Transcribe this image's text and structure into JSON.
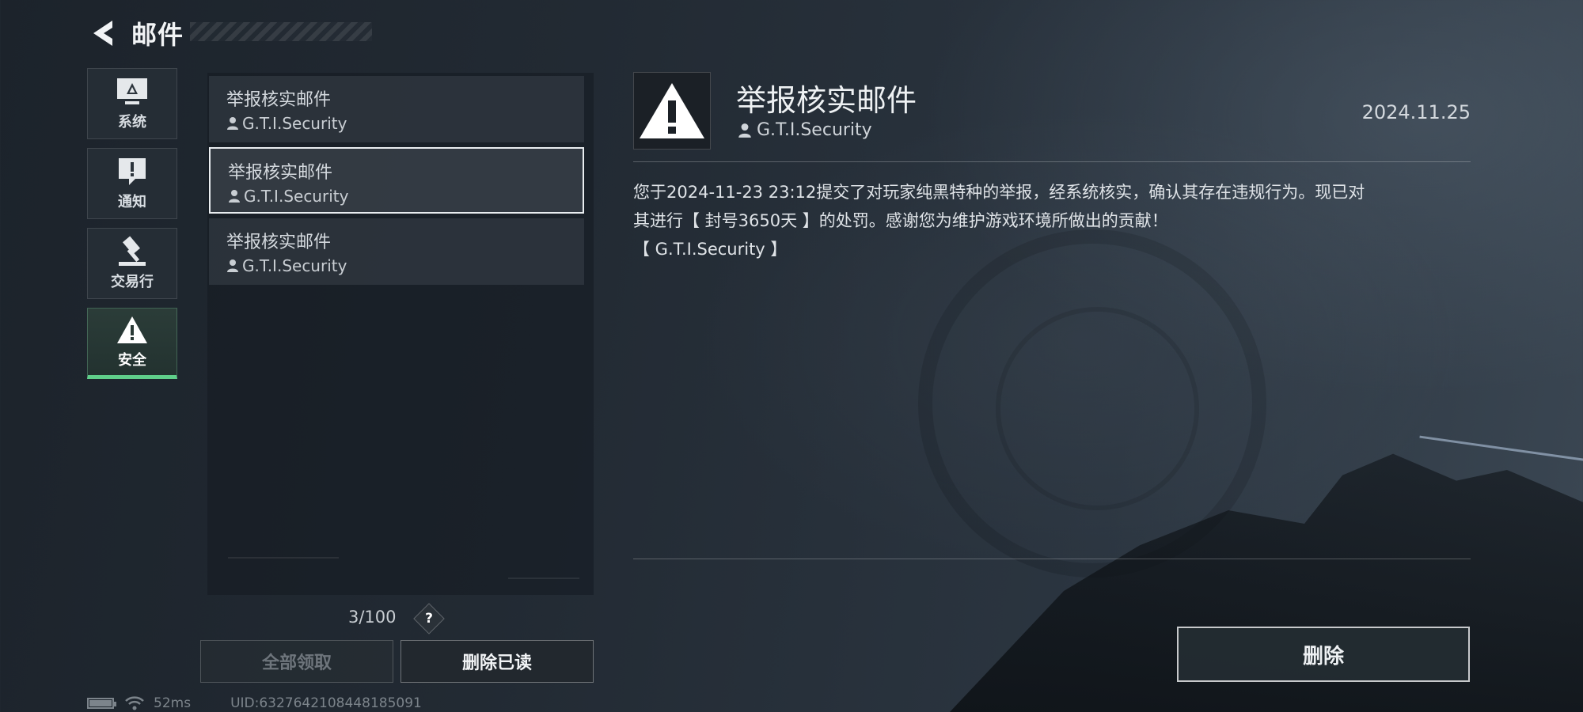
{
  "header": {
    "title": "邮件",
    "back_icon": "back-arrow-icon"
  },
  "sidebar": {
    "items": [
      {
        "label": "系统",
        "icon": "monitor-icon",
        "active": false
      },
      {
        "label": "通知",
        "icon": "exclamation-bubble-icon",
        "active": false
      },
      {
        "label": "交易行",
        "icon": "gavel-icon",
        "active": false
      },
      {
        "label": "安全",
        "icon": "warning-triangle-icon",
        "active": true
      }
    ]
  },
  "mail_list": {
    "items": [
      {
        "subject": "举报核实邮件",
        "sender": "G.T.I.Security",
        "selected": false
      },
      {
        "subject": "举报核实邮件",
        "sender": "G.T.I.Security",
        "selected": true
      },
      {
        "subject": "举报核实邮件",
        "sender": "G.T.I.Security",
        "selected": false
      }
    ],
    "count": "3/100",
    "help_label": "?"
  },
  "actions": {
    "claim_all": "全部领取",
    "delete_read": "删除已读",
    "delete": "删除"
  },
  "detail": {
    "title": "举报核实邮件",
    "sender": "G.T.I.Security",
    "date": "2024.11.25",
    "body_line1": "您于2024-11-23 23:12提交了对玩家纯黑特种的举报，经系统核实，确认其存在违规行为。现已对",
    "body_line2": "其进行【 封号3650天 】的处罚。感谢您为维护游戏环境所做出的贡献！",
    "body_line3": "【 G.T.I.Security 】"
  },
  "status": {
    "ping": "52ms",
    "uid": "UID:6327642108448185091"
  },
  "colors": {
    "accent_green": "#5fcf8a",
    "selected_border": "#e9edf0"
  }
}
